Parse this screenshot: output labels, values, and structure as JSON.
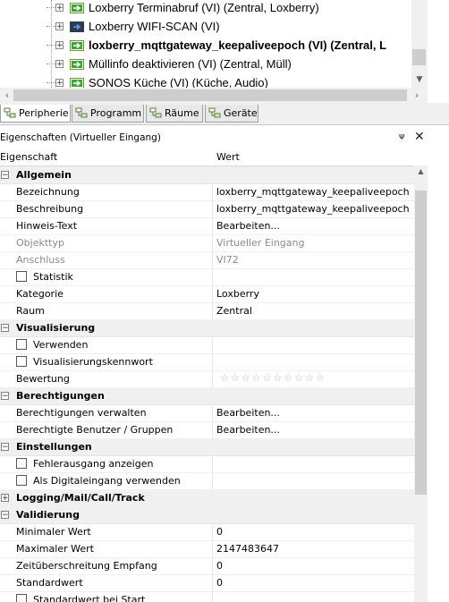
{
  "tree": {
    "items": [
      {
        "label": "Loxberry Terminabruf (VI) (Zentral, Loxberry)",
        "bold": false,
        "icon": "green-arrow-icon"
      },
      {
        "label": "Loxberry WIFI-SCAN (VI)",
        "bold": false,
        "icon": "blue-arrow-icon"
      },
      {
        "label": "loxberry_mqttgateway_keepaliveepoch (VI) (Zentral, L",
        "bold": true,
        "icon": "green-arrow-icon"
      },
      {
        "label": "Müllinfo deaktivieren (VI) (Zentral, Müll)",
        "bold": false,
        "icon": "green-arrow-icon"
      },
      {
        "label": "SONOS Küche (VI) (Küche, Audio)",
        "bold": false,
        "icon": "green-arrow-icon"
      }
    ]
  },
  "tabs": [
    {
      "label": "Peripherie",
      "active": true
    },
    {
      "label": "Programm",
      "active": false
    },
    {
      "label": "Räume",
      "active": false
    },
    {
      "label": "Geräte",
      "active": false
    }
  ],
  "panel": {
    "title": "Eigenschaften (Virtueller Eingang)",
    "pin": "ᵖ",
    "close": "✕"
  },
  "grid": {
    "col_property": "Eigenschaft",
    "col_value": "Wert",
    "rating_stars": "☆☆☆☆☆☆☆☆☆☆"
  },
  "rows": [
    {
      "type": "cat",
      "name": "Allgemein",
      "toggle": "−"
    },
    {
      "type": "prop",
      "name": "Bezeichnung",
      "value": "loxberry_mqttgateway_keepaliveepoch"
    },
    {
      "type": "prop",
      "name": "Beschreibung",
      "value": "loxberry_mqttgateway_keepaliveepoch"
    },
    {
      "type": "prop",
      "name": "Hinweis-Text",
      "value": "Bearbeiten..."
    },
    {
      "type": "dim",
      "name": "Objekttyp",
      "value": "Virtueller Eingang"
    },
    {
      "type": "dim",
      "name": "Anschluss",
      "value": "VI72"
    },
    {
      "type": "check",
      "name": "Statistik",
      "value": ""
    },
    {
      "type": "prop",
      "name": "Kategorie",
      "value": "Loxberry"
    },
    {
      "type": "prop",
      "name": "Raum",
      "value": "Zentral"
    },
    {
      "type": "cat",
      "name": "Visualisierung",
      "toggle": "−"
    },
    {
      "type": "check",
      "name": "Verwenden",
      "value": ""
    },
    {
      "type": "check",
      "name": "Visualisierungskennwort",
      "value": ""
    },
    {
      "type": "stars",
      "name": "Bewertung",
      "value": ""
    },
    {
      "type": "cat",
      "name": "Berechtigungen",
      "toggle": "−"
    },
    {
      "type": "prop",
      "name": "Berechtigungen verwalten",
      "value": "Bearbeiten..."
    },
    {
      "type": "prop",
      "name": "Berechtigte Benutzer / Gruppen",
      "value": "Bearbeiten..."
    },
    {
      "type": "cat",
      "name": "Einstellungen",
      "toggle": "−"
    },
    {
      "type": "check",
      "name": "Fehlerausgang anzeigen",
      "value": ""
    },
    {
      "type": "check",
      "name": "Als Digitaleingang verwenden",
      "value": ""
    },
    {
      "type": "cat",
      "name": "Logging/Mail/Call/Track",
      "toggle": "+"
    },
    {
      "type": "cat",
      "name": "Validierung",
      "toggle": "−"
    },
    {
      "type": "prop",
      "name": "Minimaler Wert",
      "value": "0"
    },
    {
      "type": "prop",
      "name": "Maximaler Wert",
      "value": "2147483647"
    },
    {
      "type": "prop",
      "name": "Zeitüberschreitung Empfang",
      "value": "0"
    },
    {
      "type": "prop",
      "name": "Standardwert",
      "value": "0"
    },
    {
      "type": "check",
      "name": "Standardwert bei Start",
      "value": ""
    }
  ]
}
